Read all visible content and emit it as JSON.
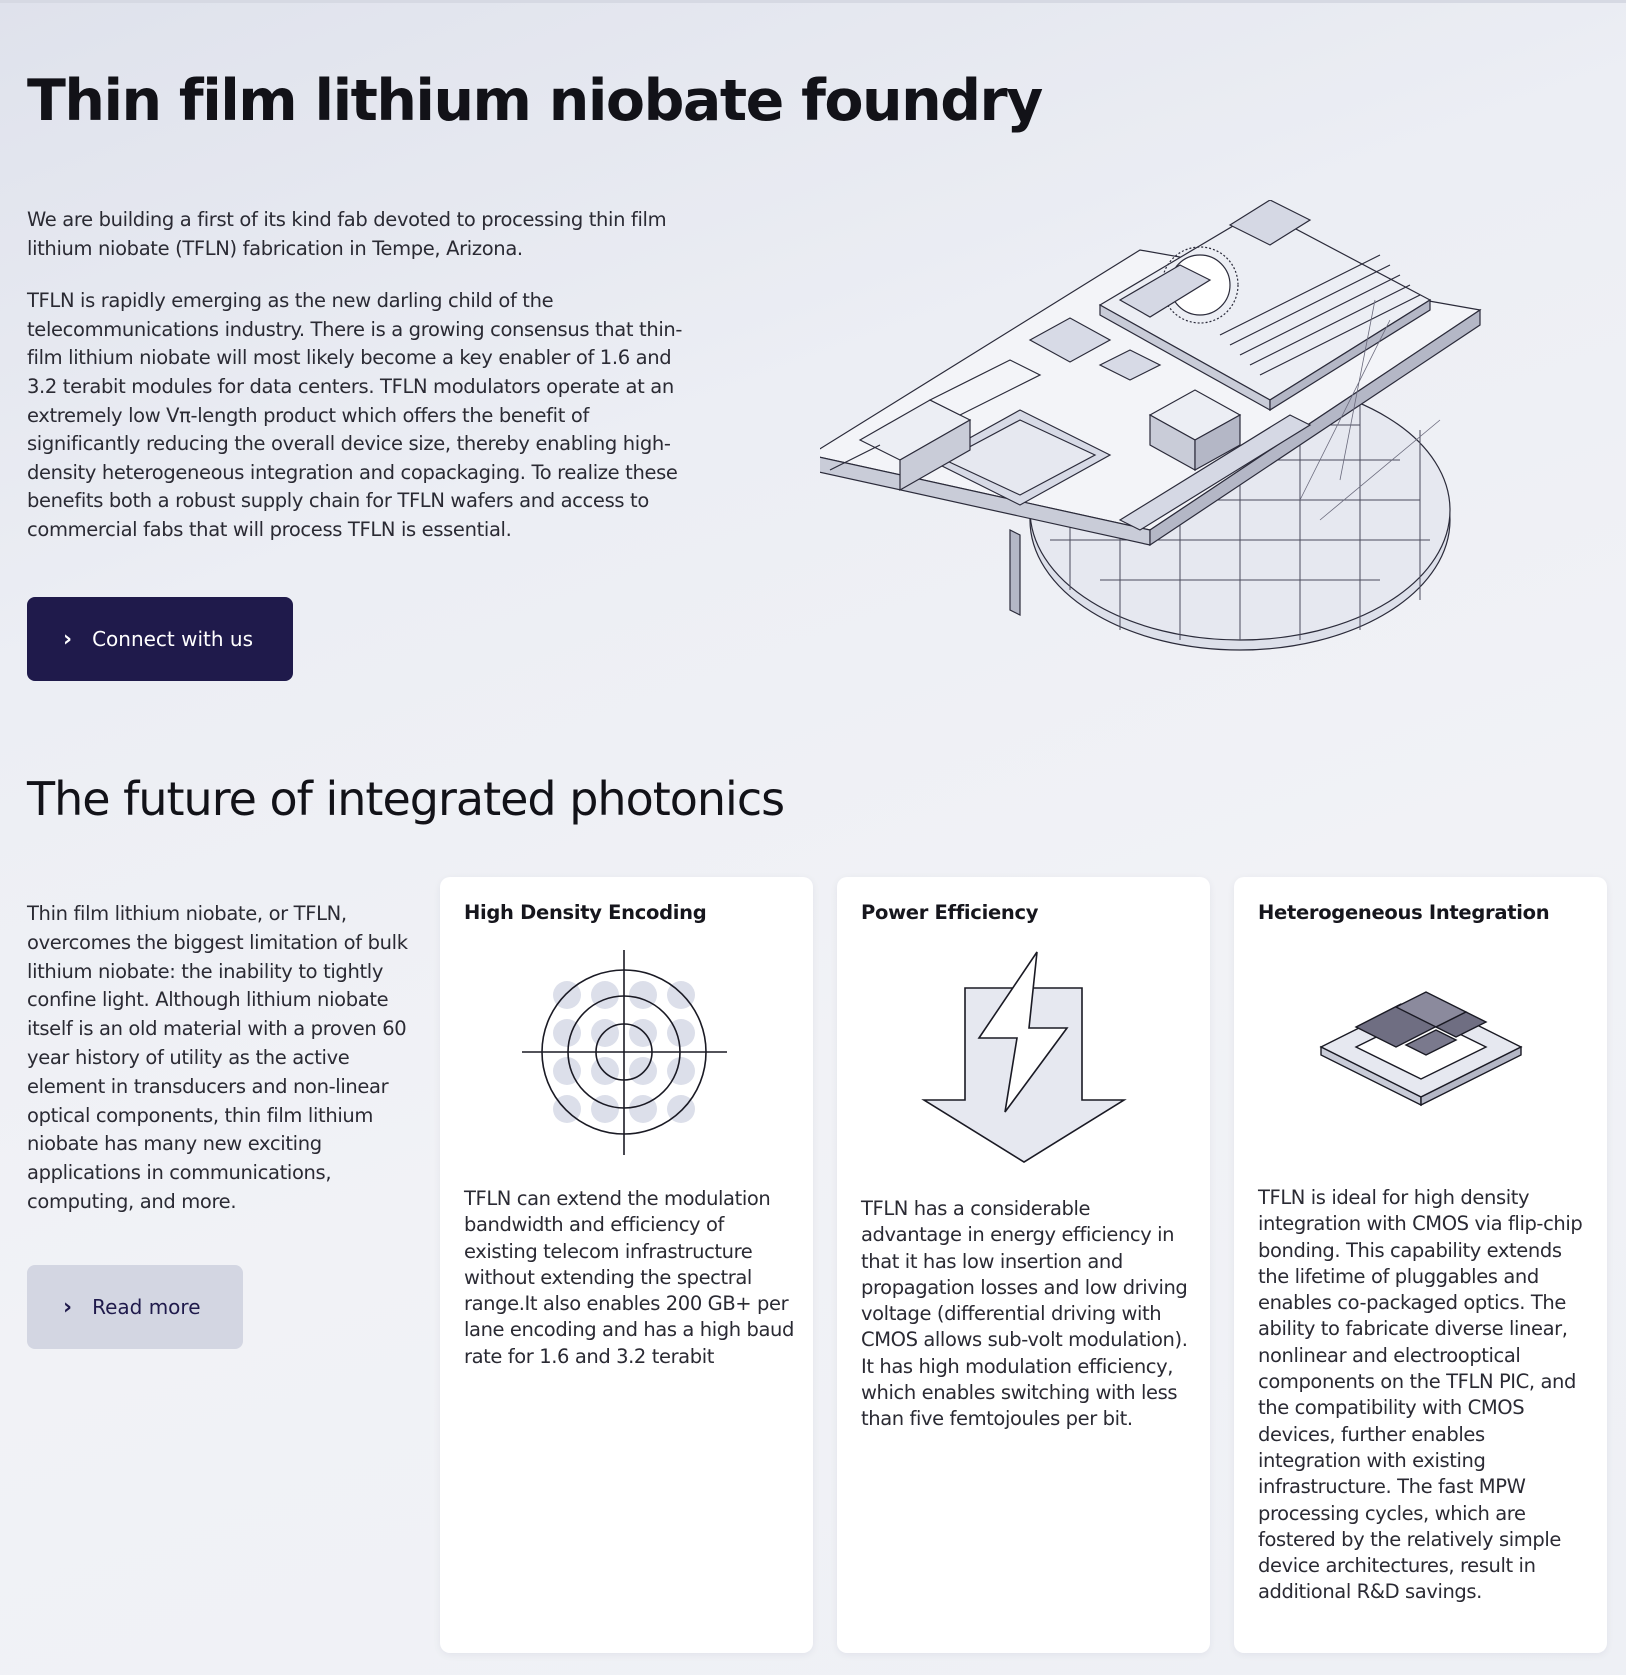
{
  "hero": {
    "title": "Thin film lithium niobate foundry",
    "paragraph1": "We are building a first of its kind fab devoted to processing thin film lithium niobate (TFLN) fabrication in Tempe, Arizona.",
    "paragraph2": "TFLN is rapidly emerging as the new darling child of the telecommunications industry. There is a growing consensus that thin-film lithium niobate will most likely become a key enabler of 1.6 and 3.2 terabit modules for data centers. TFLN modulators operate at an extremely low Vπ-length product which offers the benefit of significantly reducing the overall device size, thereby enabling high-density heterogeneous integration and copackaging. To realize these benefits both a robust supply chain for TFLN wafers and access to commercial fabs that will process TFLN is essential.",
    "cta_label": "Connect with us",
    "illustration_icon": "photonic-chip-wafer-illustration"
  },
  "future": {
    "title": "The future of integrated photonics",
    "text": "Thin film lithium niobate, or TFLN, overcomes the biggest limitation of bulk lithium niobate: the inability to tightly confine light.  Although lithium niobate itself is an old material with a proven 60 year history of utility as the active element in transducers and non-linear optical components, thin film lithium niobate has many new exciting applications in communications, computing, and more.",
    "cta_label": "Read more",
    "cards": [
      {
        "title": "High Density Encoding",
        "icon": "constellation-target-icon",
        "body": "TFLN can extend the modulation bandwidth and efficiency of existing telecom infrastructure without extending the spectral range.It also enables 200 GB+ per lane encoding and has a high baud rate for 1.6 and 3.2 terabit"
      },
      {
        "title": "Power Efficiency",
        "icon": "lightning-arrow-icon",
        "body": "TFLN has a considerable advantage in energy efficiency in that it has low insertion and propagation losses and low driving voltage (differential driving with CMOS allows sub-volt modulation). It has high modulation efficiency, which enables switching with less than five femtojoules per bit."
      },
      {
        "title": "Heterogeneous Integration",
        "icon": "stacked-chips-icon",
        "body": "TFLN is ideal for high density integration with CMOS via flip-chip bonding. This capability extends the lifetime of pluggables and enables co-packaged optics. The ability to fabricate diverse linear, nonlinear and electrooptical components on the TFLN PIC, and the compatibility with CMOS devices, further enables integration with existing infrastructure. The fast MPW processing cycles, which are fostered by the relatively simple device architectures, result in additional R&D savings."
      }
    ]
  },
  "colors": {
    "primary": "#1f1a4b",
    "secondary_button": "#d3d6e2",
    "icon_fill": "#dcdfea"
  }
}
